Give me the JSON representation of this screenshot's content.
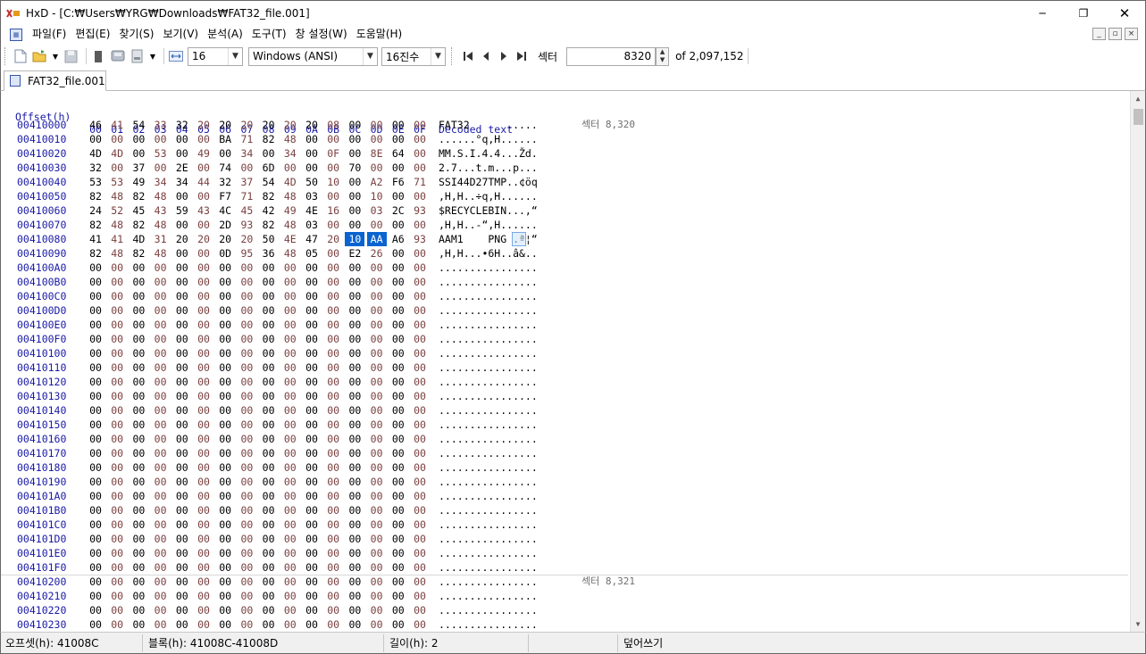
{
  "window": {
    "title": "HxD - [C:₩Users₩YRG₩Downloads₩FAT32_file.001]",
    "minimize": "─",
    "restore": "❐",
    "close": "✕"
  },
  "menu": {
    "items": [
      "파일(F)",
      "편집(E)",
      "찾기(S)",
      "보기(V)",
      "분석(A)",
      "도구(T)",
      "창 설정(W)",
      "도움말(H)"
    ],
    "mdi": [
      "_",
      "▫",
      "×"
    ]
  },
  "toolbar": {
    "bytes_per_row": "16",
    "charset": "Windows (ANSI)",
    "offset_base": "16진수",
    "sector_label": "섹터",
    "sector_value": "8320",
    "sector_total": "of 2,097,152"
  },
  "tab": {
    "label": "FAT32_file.001"
  },
  "hex": {
    "header_offset": "Offset(h)",
    "header_columns": [
      "00",
      "01",
      "02",
      "03",
      "04",
      "05",
      "06",
      "07",
      "08",
      "09",
      "0A",
      "0B",
      "0C",
      "0D",
      "0E",
      "0F"
    ],
    "header_decoded": "Decoded text",
    "rows": [
      {
        "offset": "00410000",
        "bytes": [
          "46",
          "41",
          "54",
          "33",
          "32",
          "20",
          "20",
          "20",
          "20",
          "20",
          "20",
          "08",
          "00",
          "00",
          "00",
          "00"
        ],
        "decoded": "FAT32      .....",
        "sector": "섹터 8,320"
      },
      {
        "offset": "00410010",
        "bytes": [
          "00",
          "00",
          "00",
          "00",
          "00",
          "00",
          "BA",
          "71",
          "82",
          "48",
          "00",
          "00",
          "00",
          "00",
          "00",
          "00"
        ],
        "decoded": "......°q,H......"
      },
      {
        "offset": "00410020",
        "bytes": [
          "4D",
          "4D",
          "00",
          "53",
          "00",
          "49",
          "00",
          "34",
          "00",
          "34",
          "00",
          "0F",
          "00",
          "8E",
          "64",
          "00"
        ],
        "decoded": "MM.S.I.4.4...Žd."
      },
      {
        "offset": "00410030",
        "bytes": [
          "32",
          "00",
          "37",
          "00",
          "2E",
          "00",
          "74",
          "00",
          "6D",
          "00",
          "00",
          "00",
          "70",
          "00",
          "00",
          "00"
        ],
        "decoded": "2.7...t.m...p..."
      },
      {
        "offset": "00410040",
        "bytes": [
          "53",
          "53",
          "49",
          "34",
          "34",
          "44",
          "32",
          "37",
          "54",
          "4D",
          "50",
          "10",
          "00",
          "A2",
          "F6",
          "71"
        ],
        "decoded": "SSI44D27TMP..¢öq"
      },
      {
        "offset": "00410050",
        "bytes": [
          "82",
          "48",
          "82",
          "48",
          "00",
          "00",
          "F7",
          "71",
          "82",
          "48",
          "03",
          "00",
          "00",
          "10",
          "00",
          "00"
        ],
        "decoded": ",H,H..÷q,H......"
      },
      {
        "offset": "00410060",
        "bytes": [
          "24",
          "52",
          "45",
          "43",
          "59",
          "43",
          "4C",
          "45",
          "42",
          "49",
          "4E",
          "16",
          "00",
          "03",
          "2C",
          "93"
        ],
        "decoded": "$RECYCLEBIN...,“"
      },
      {
        "offset": "00410070",
        "bytes": [
          "82",
          "48",
          "82",
          "48",
          "00",
          "00",
          "2D",
          "93",
          "82",
          "48",
          "03",
          "00",
          "00",
          "00",
          "00",
          "00"
        ],
        "decoded": ",H,H..-“,H......"
      },
      {
        "offset": "00410080",
        "bytes": [
          "41",
          "41",
          "4D",
          "31",
          "20",
          "20",
          "20",
          "20",
          "50",
          "4E",
          "47",
          "20",
          "10",
          "AA",
          "A6",
          "93"
        ],
        "decoded": "AAM1    PNG .ª¦“"
      },
      {
        "offset": "00410090",
        "bytes": [
          "82",
          "48",
          "82",
          "48",
          "00",
          "00",
          "0D",
          "95",
          "36",
          "48",
          "05",
          "00",
          "E2",
          "26",
          "00",
          "00"
        ],
        "decoded": ",H,H...•6H..â&.."
      },
      {
        "offset": "004100A0",
        "zero": true
      },
      {
        "offset": "004100B0",
        "zero": true
      },
      {
        "offset": "004100C0",
        "zero": true
      },
      {
        "offset": "004100D0",
        "zero": true
      },
      {
        "offset": "004100E0",
        "zero": true
      },
      {
        "offset": "004100F0",
        "zero": true
      },
      {
        "offset": "00410100",
        "zero": true
      },
      {
        "offset": "00410110",
        "zero": true
      },
      {
        "offset": "00410120",
        "zero": true
      },
      {
        "offset": "00410130",
        "zero": true
      },
      {
        "offset": "00410140",
        "zero": true
      },
      {
        "offset": "00410150",
        "zero": true
      },
      {
        "offset": "00410160",
        "zero": true
      },
      {
        "offset": "00410170",
        "zero": true
      },
      {
        "offset": "00410180",
        "zero": true
      },
      {
        "offset": "00410190",
        "zero": true
      },
      {
        "offset": "004101A0",
        "zero": true
      },
      {
        "offset": "004101B0",
        "zero": true
      },
      {
        "offset": "004101C0",
        "zero": true
      },
      {
        "offset": "004101D0",
        "zero": true
      },
      {
        "offset": "004101E0",
        "zero": true
      },
      {
        "offset": "004101F0",
        "zero": true
      },
      {
        "offset": "00410200",
        "zero": true,
        "sector": "섹터 8,321"
      },
      {
        "offset": "00410210",
        "zero": true
      },
      {
        "offset": "00410220",
        "zero": true
      },
      {
        "offset": "00410230",
        "zero": true
      }
    ],
    "zero_byte": "00",
    "zero_decoded": "................"
  },
  "status": {
    "offset": "오프셋(h): 41008C",
    "block": "블록(h): 41008C-41008D",
    "length": "길이(h): 2",
    "mode": "덮어쓰기"
  },
  "colors": {
    "offset_blue": "#1a1aa6",
    "odd_column": "#7a3f3f",
    "selection": "#0a64d0"
  }
}
